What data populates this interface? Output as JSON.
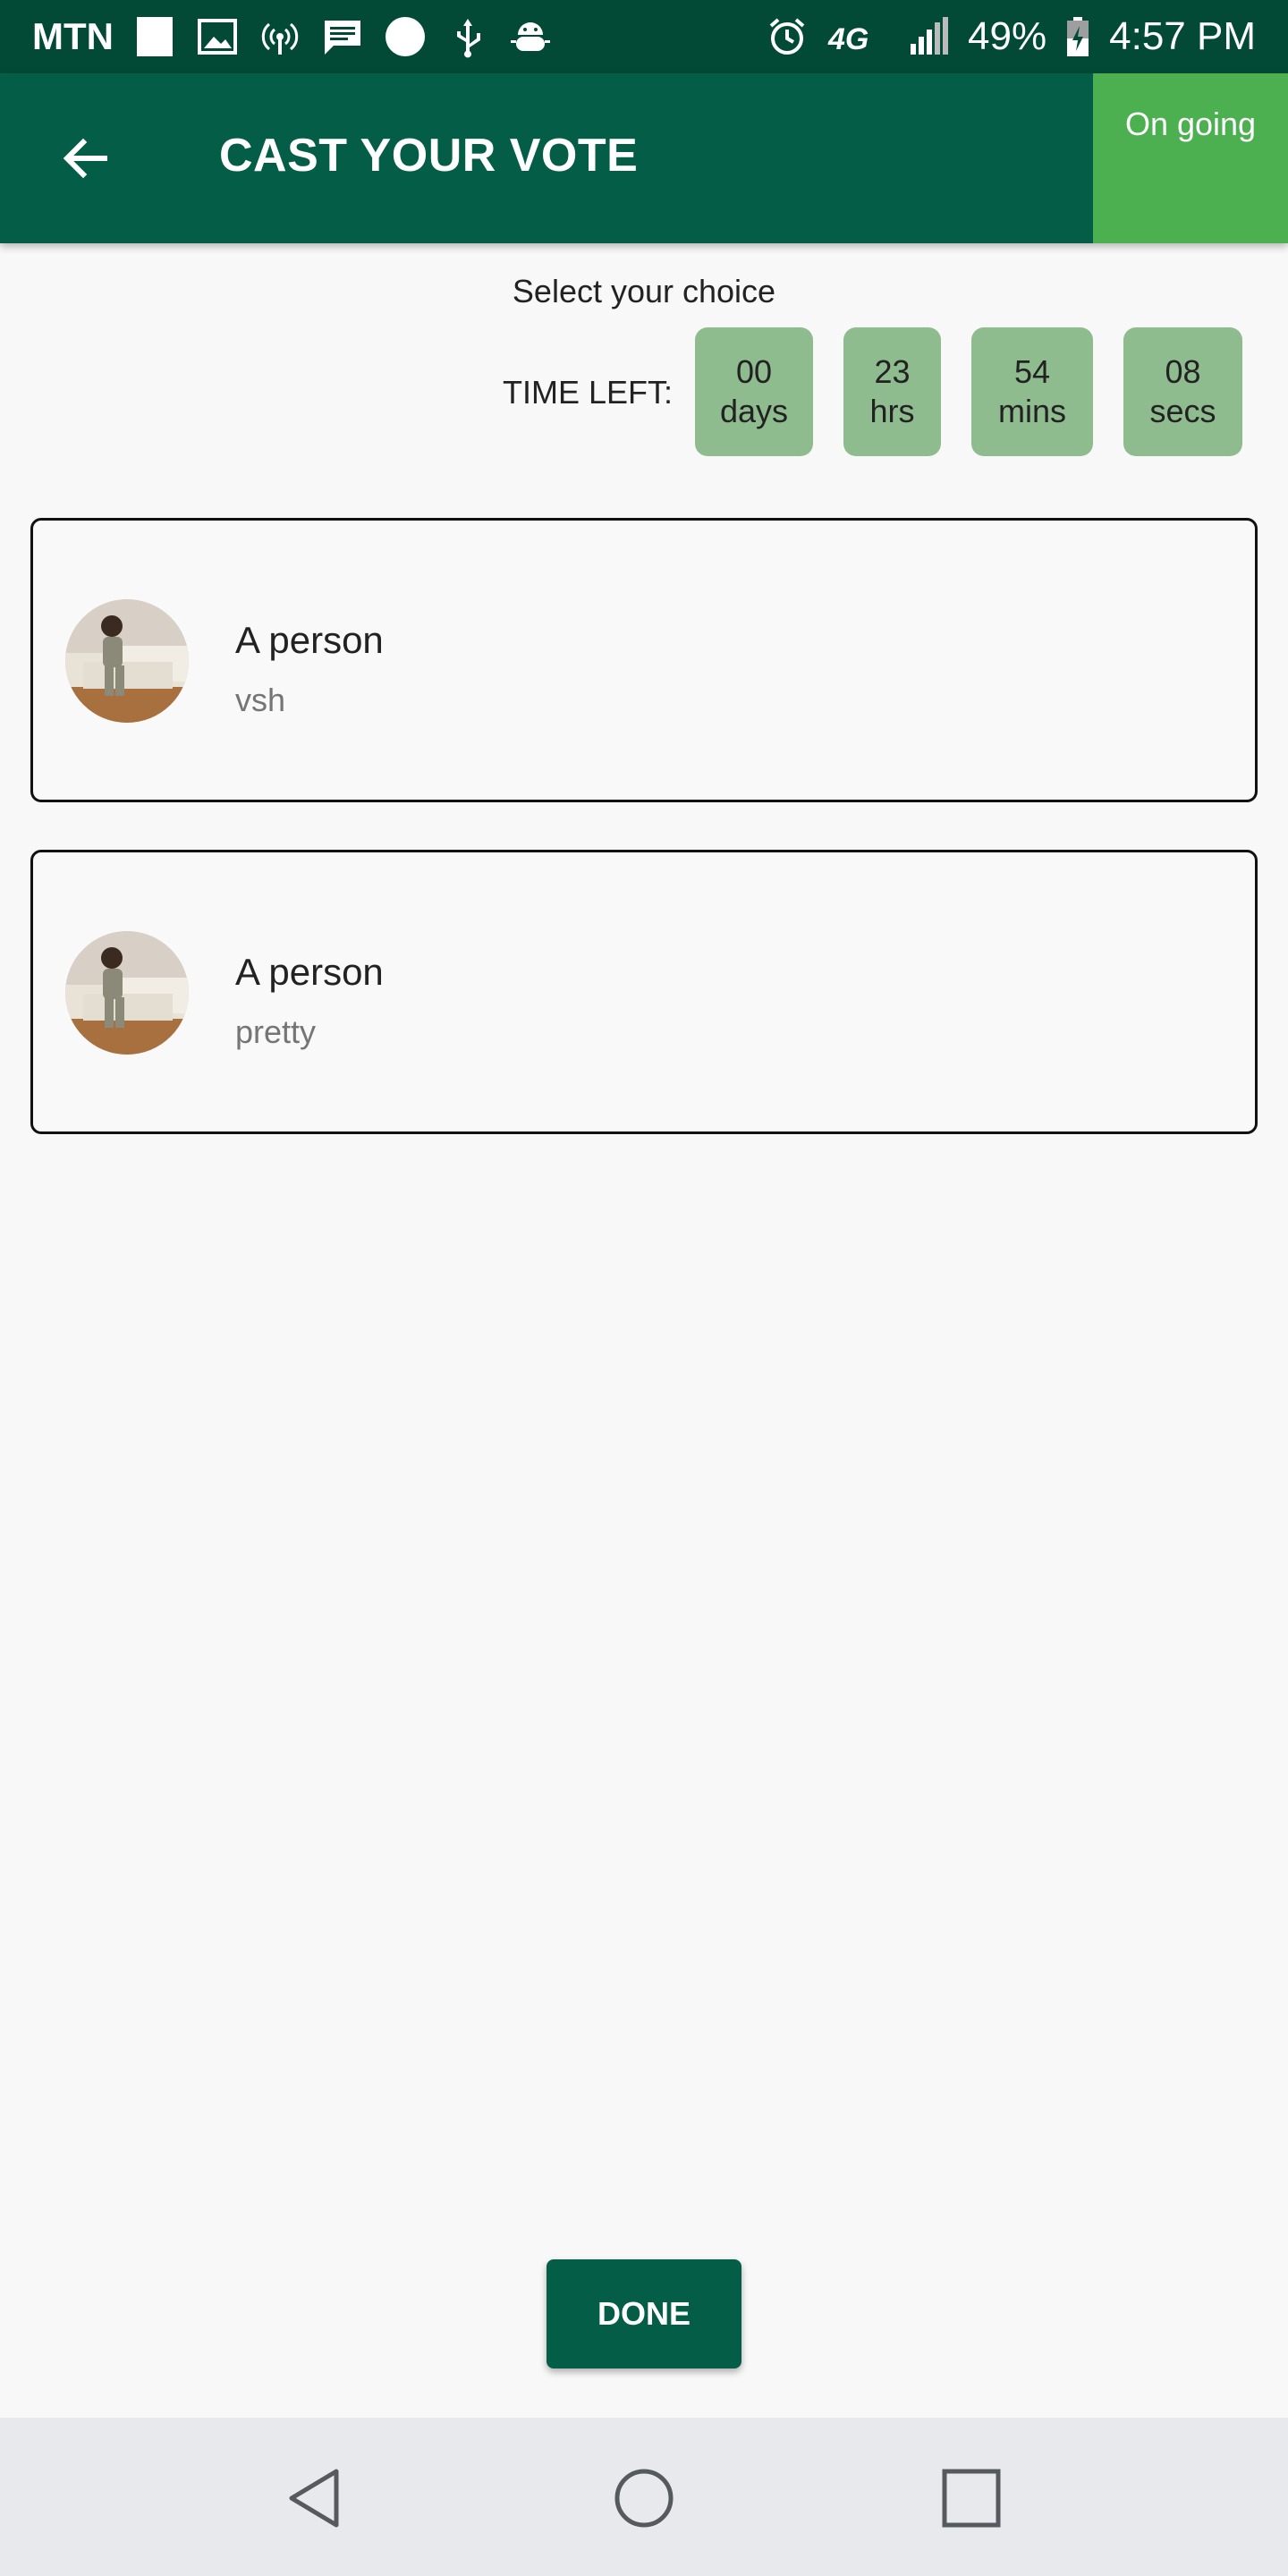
{
  "status_bar": {
    "carrier": "MTN",
    "network": "4G",
    "battery": "49%",
    "time": "4:57 PM"
  },
  "app_bar": {
    "title": "CAST YOUR VOTE",
    "status": "On going"
  },
  "instruction": "Select your choice",
  "timer": {
    "label": "TIME LEFT:",
    "days": {
      "value": "00",
      "unit": "days"
    },
    "hours": {
      "value": "23",
      "unit": "hrs"
    },
    "minutes": {
      "value": "54",
      "unit": "mins"
    },
    "seconds": {
      "value": "08",
      "unit": "secs"
    }
  },
  "candidates": [
    {
      "name": "A person",
      "subtitle": "vsh"
    },
    {
      "name": "A person",
      "subtitle": "pretty"
    }
  ],
  "done_label": "DONE",
  "colors": {
    "status_bar": "#024a36",
    "app_bar": "#045d47",
    "status_chip": "#4caf50",
    "timer_box": "#8fbc8f",
    "done_button": "#045d47"
  }
}
